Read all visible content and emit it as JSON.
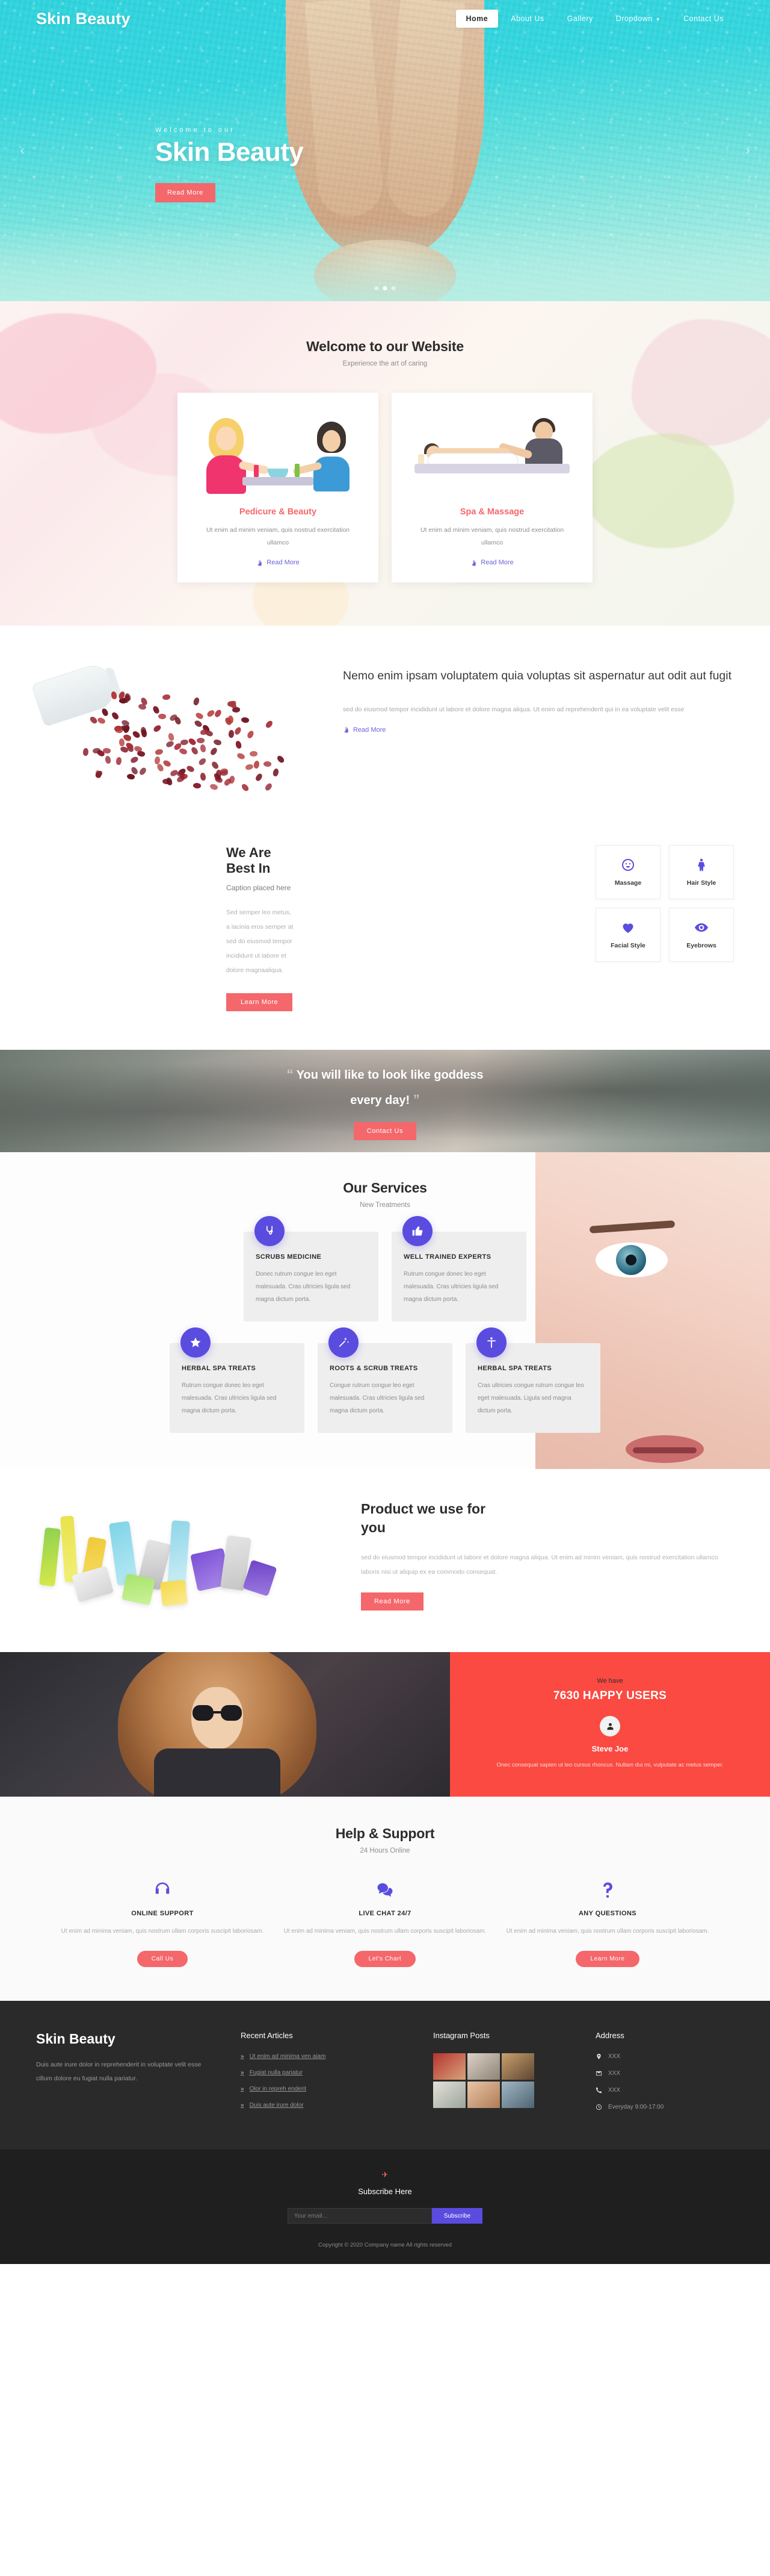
{
  "site": {
    "brand": "Skin Beauty"
  },
  "nav": {
    "items": [
      {
        "label": "Home",
        "active": true
      },
      {
        "label": "About Us",
        "active": false
      },
      {
        "label": "Gallery",
        "active": false
      },
      {
        "label": "Dropdown",
        "active": false,
        "caret": true
      },
      {
        "label": "Contact Us",
        "active": false
      }
    ]
  },
  "hero": {
    "pretitle": "Welcome to our",
    "title": "Skin Beauty",
    "button": "Read More",
    "slide_count": 3,
    "active_slide": 2,
    "prev_icon": "chevron-left-icon",
    "next_icon": "chevron-right-icon"
  },
  "welcome": {
    "title": "Welcome to our Website",
    "subtitle": "Experience the art of caring",
    "cards": [
      {
        "title": "Pedicure & Beauty",
        "text": "Ut enim ad minim veniam, quis nostrud exercitation ullamco",
        "link": "Read More"
      },
      {
        "title": "Spa & Massage",
        "text": "Ut enim ad minim veniam, quis nostrud exercitation ullamco",
        "link": "Read More"
      }
    ]
  },
  "nemo": {
    "heading": "Nemo enim ipsam voluptatem quia voluptas sit aspernatur aut odit aut fugit",
    "paragraph": "sed do eiusmod tempor incididunt ut labore et dolore magna aliqua. Ut enim ad reprehenderit qui in ea voluptate velit esse",
    "link": "Read More"
  },
  "bestin": {
    "title": "We Are Best In",
    "caption": "Caption placed here",
    "paragraph": "Sed semper leo metus, a lacinia eros semper at sed do eiusmod tempor incididunt ut labore et dolore magnaaliqua.",
    "button": "Learn More",
    "boxes": [
      {
        "label": "Massage",
        "icon": "smiley-face-icon"
      },
      {
        "label": "Hair Style",
        "icon": "female-figure-icon"
      },
      {
        "label": "Facial Style",
        "icon": "heart-icon"
      },
      {
        "label": "Eyebrows",
        "icon": "eye-icon"
      }
    ]
  },
  "quote": {
    "line1": "You will like to look like goddess",
    "line2": "every day!",
    "open_quote": "“",
    "close_quote": "”",
    "button": "Contact Us"
  },
  "services": {
    "title": "Our Services",
    "subtitle": "New Treatments",
    "row1": [
      {
        "title": "SCRUBS MEDICINE",
        "text": "Donec rutrum congue leo eget malesuada. Cras ultricies ligula sed magna dictum porta.",
        "icon": "stethoscope-icon"
      },
      {
        "title": "WELL TRAINED EXPERTS",
        "text": "Rutrum congue donec leo eget malesuada. Cras ultricies ligula sed magna dictum porta.",
        "icon": "thumbs-up-icon"
      }
    ],
    "row2": [
      {
        "title": "HERBAL SPA TREATS",
        "text": "Rutrum congue donec leo eget malesuada. Cras ultricies ligula sed magna dictum porta.",
        "icon": "star-icon"
      },
      {
        "title": "ROOTS & SCRUB TREATS",
        "text": "Congue rutrum congue leo eget malesuada. Cras ultricies ligula sed magna dictum porta.",
        "icon": "magic-wand-icon"
      },
      {
        "title": "HERBAL SPA TREATS",
        "text": "Cras ultricies congue rutrum congue leo eget malesuada. Ligula sed magna dictum porta.",
        "icon": "person-icon"
      }
    ]
  },
  "product": {
    "title": "Product we use for you",
    "paragraph": "sed do eiusmod tempor incididunt ut labore et dolore magna aliqua. Ut enim ad minim veniam, quis nostrud exercitation ullamco laboris nisi ut aliquip ex ea commodo consequat.",
    "button": "Read More"
  },
  "happy": {
    "we_have": "We have",
    "count": "7630 HAPPY USERS",
    "avatar_icon": "user-icon",
    "name": "Steve Joe",
    "quote": "Onec consequat sapien ut leo cursus rhoncus. Nullam dui mi, vulputate ac metus semper."
  },
  "help": {
    "title": "Help & Support",
    "subtitle": "24 Hours Online",
    "columns": [
      {
        "title": "ONLINE SUPPORT",
        "text": "Ut enim ad minima veniam, quis nostrum ullam corporis suscipit laboriosam.",
        "button": "Call Us",
        "icon": "headphones-icon"
      },
      {
        "title": "LIVE CHAT 24/7",
        "text": "Ut enim ad minima veniam, quis nostrum ullam corporis suscipit laboriosam.",
        "button": "Let's Chart",
        "icon": "chat-bubbles-icon"
      },
      {
        "title": "ANY QUESTIONS",
        "text": "Ut enim ad minima veniam, quis nostrum ullam corporis suscipit laboriosam.",
        "button": "Learn More",
        "icon": "question-mark-icon"
      }
    ]
  },
  "footer": {
    "brand": "Skin Beauty",
    "about": "Duis aute irure dolor in reprehenderit in voluptate velit esse cillum dolore eu fugiat nulla pariatur.",
    "articles_heading": "Recent Articles",
    "articles": [
      "Ut enim ad minima ven aiam",
      "Fugiat nulla pariatur",
      "Olor in repreh enderit",
      "Duis aute irure dolor"
    ],
    "instagram_heading": "Instagram Posts",
    "address_heading": "Address",
    "address": [
      {
        "icon": "map-pin-icon",
        "text": "XXX"
      },
      {
        "icon": "envelope-icon",
        "text": "XXX"
      },
      {
        "icon": "phone-icon",
        "text": "XXX"
      },
      {
        "icon": "clock-icon",
        "text": "Everyday 9:00-17:00"
      }
    ]
  },
  "subscribe": {
    "icon": "paper-plane-icon",
    "title": "Subscribe Here",
    "placeholder": "Your email...",
    "value": "",
    "button": "Subscribe"
  },
  "copyright": "Copyright © 2020 Company name All rights reserved",
  "colors": {
    "hero_teal": "#35d6de",
    "coral": "#f4676b",
    "purple": "#5b4ce0",
    "red": "#fa4a41",
    "footer_dark": "#2a2a2a",
    "subscribe_dark": "#1f1f1f"
  }
}
